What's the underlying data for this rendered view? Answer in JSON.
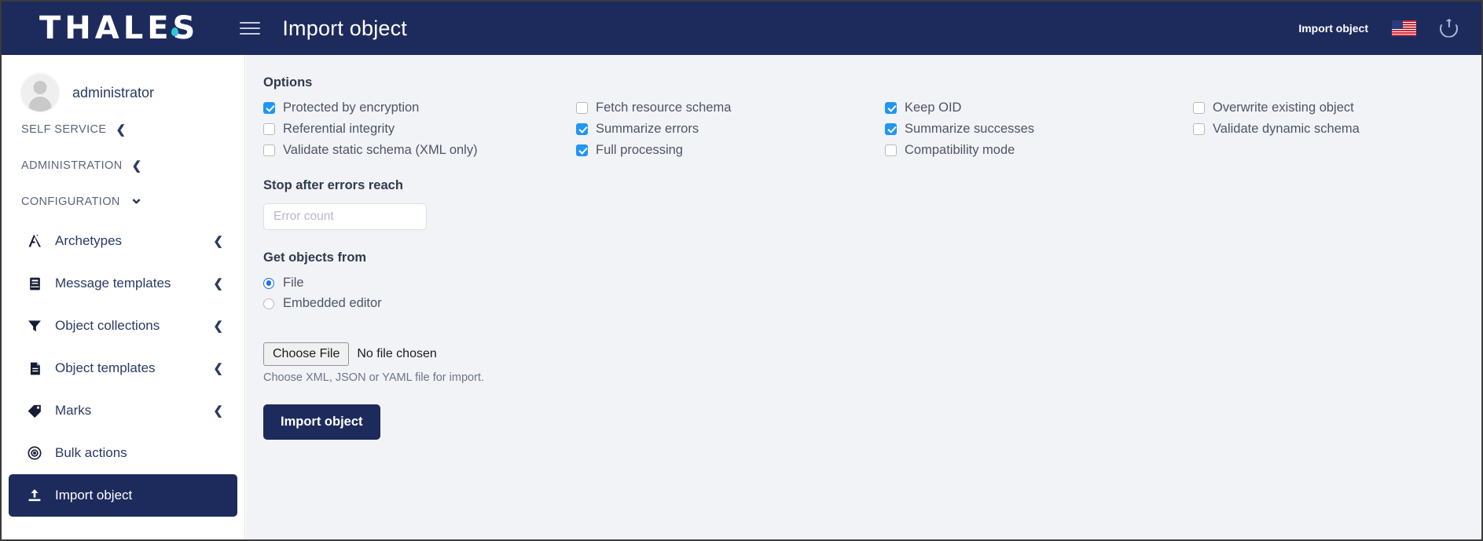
{
  "topbar": {
    "brand": "THALES",
    "menu_icon": "hamburger-icon",
    "page_title": "Import object",
    "import_link": "Import object",
    "language_icon": "us-flag-icon",
    "logout_icon": "power-icon"
  },
  "sidebar": {
    "user": "administrator",
    "avatar_icon": "user-avatar-icon",
    "sections": [
      {
        "label": "SELF SERVICE",
        "chevron": "chevron-left-icon"
      },
      {
        "label": "ADMINISTRATION",
        "chevron": "chevron-left-icon"
      },
      {
        "label": "CONFIGURATION",
        "chevron": "chevron-down-icon"
      }
    ],
    "items": [
      {
        "label": "Archetypes",
        "icon": "archetype-a-icon",
        "chevron": "chevron-left-icon",
        "active": false
      },
      {
        "label": "Message templates",
        "icon": "book-icon",
        "chevron": "chevron-left-icon",
        "active": false
      },
      {
        "label": "Object collections",
        "icon": "funnel-icon",
        "chevron": "chevron-left-icon",
        "active": false
      },
      {
        "label": "Object templates",
        "icon": "document-icon",
        "chevron": "chevron-left-icon",
        "active": false
      },
      {
        "label": "Marks",
        "icon": "tag-icon",
        "chevron": "chevron-left-icon",
        "active": false
      },
      {
        "label": "Bulk actions",
        "icon": "target-icon",
        "chevron": "",
        "active": false
      },
      {
        "label": "Import object",
        "icon": "upload-icon",
        "chevron": "",
        "active": true
      }
    ]
  },
  "main": {
    "options_title": "Options",
    "options": [
      [
        {
          "label": "Protected by encryption",
          "checked": true
        },
        {
          "label": "Referential integrity",
          "checked": false
        },
        {
          "label": "Validate static schema (XML only)",
          "checked": false
        }
      ],
      [
        {
          "label": "Fetch resource schema",
          "checked": false
        },
        {
          "label": "Summarize errors",
          "checked": true
        },
        {
          "label": "Full processing",
          "checked": true
        }
      ],
      [
        {
          "label": "Keep OID",
          "checked": true
        },
        {
          "label": "Summarize successes",
          "checked": true
        },
        {
          "label": "Compatibility mode",
          "checked": false
        }
      ],
      [
        {
          "label": "Overwrite existing object",
          "checked": false
        },
        {
          "label": "Validate dynamic schema",
          "checked": false
        }
      ]
    ],
    "stop_title": "Stop after errors reach",
    "error_count_placeholder": "Error count",
    "error_count_value": "",
    "get_objects_title": "Get objects from",
    "sources": [
      {
        "label": "File",
        "selected": true
      },
      {
        "label": "Embedded editor",
        "selected": false
      }
    ],
    "choose_file_label": "Choose File",
    "file_status": "No file chosen",
    "file_hint": "Choose XML, JSON or YAML file for import.",
    "submit_label": "Import object"
  },
  "colors": {
    "brand_navy": "#1d2b5c",
    "checkbox_blue": "#2196f3",
    "radio_blue": "#1a73e8",
    "content_bg": "#f2f3f7",
    "logo_accent": "#2ec7d6"
  }
}
